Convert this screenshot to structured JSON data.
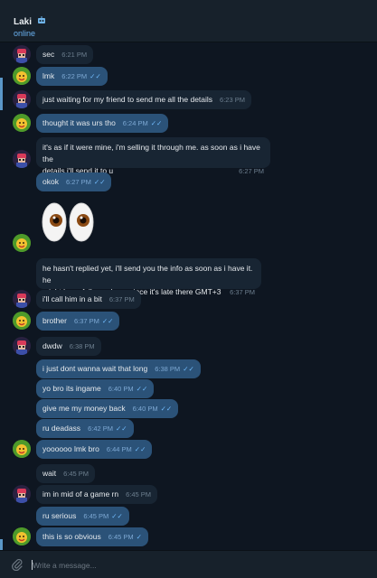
{
  "header": {
    "name": "Laki",
    "robot_icon": "robot-icon",
    "status": "online"
  },
  "messages": [
    {
      "text": "sec",
      "time": "6:21 PM",
      "dir": "in"
    },
    {
      "text": "lmk",
      "time": "6:22 PM",
      "dir": "out",
      "ticks": "✓✓"
    },
    {
      "text": "just waiting for my friend to send me all the details",
      "time": "6:23 PM",
      "dir": "in"
    },
    {
      "text": "thought it was urs tho",
      "time": "6:24 PM",
      "dir": "out",
      "ticks": "✓✓"
    },
    {
      "line1": "it's as if it were mine, i'm selling it through me. as soon as i have the",
      "line2": "details i'll send it to u",
      "time": "6:27 PM",
      "dir": "in"
    },
    {
      "text": "okok",
      "time": "6:27 PM",
      "dir": "out",
      "ticks": "✓✓"
    },
    {
      "sticker": "eyes-emoji"
    },
    {
      "line1": "he hasn't replied yet, i'll send you the info as soon as i have it. he",
      "line2": "might have fallen asleep, since it's late there GMT+3",
      "time": "6:37 PM",
      "dir": "in"
    },
    {
      "text": "i'll call him in a bit",
      "time": "6:37 PM",
      "dir": "in"
    },
    {
      "text": "brother",
      "time": "6:37 PM",
      "dir": "out",
      "ticks": "✓✓"
    },
    {
      "text": "dwdw",
      "time": "6:38 PM",
      "dir": "in"
    },
    {
      "text": "i just dont wanna wait that long",
      "time": "6:38 PM",
      "dir": "out",
      "ticks": "✓✓"
    },
    {
      "text": "yo bro its ingame",
      "time": "6:40 PM",
      "dir": "out",
      "ticks": "✓✓"
    },
    {
      "text": "give me my money back",
      "time": "6:40 PM",
      "dir": "out",
      "ticks": "✓✓"
    },
    {
      "text": "ru deadass",
      "time": "6:42 PM",
      "dir": "out",
      "ticks": "✓✓"
    },
    {
      "text": "yoooooo lmk bro",
      "time": "6:44 PM",
      "dir": "out",
      "ticks": "✓✓"
    },
    {
      "text": "wait",
      "time": "6:45 PM",
      "dir": "in"
    },
    {
      "text": "im in mid of a game rn",
      "time": "6:45 PM",
      "dir": "in"
    },
    {
      "text": "ru serious",
      "time": "6:45 PM",
      "dir": "out",
      "ticks": "✓✓"
    },
    {
      "text": "this is so obvious",
      "time": "6:45 PM",
      "dir": "out",
      "ticks": "✓"
    }
  ],
  "composer": {
    "placeholder": "Write a message...",
    "attach_icon": "paperclip-icon"
  },
  "colors": {
    "background": "#0e1621",
    "incoming": "#182533",
    "outgoing": "#2b5278",
    "accent": "#6ab2f2"
  }
}
